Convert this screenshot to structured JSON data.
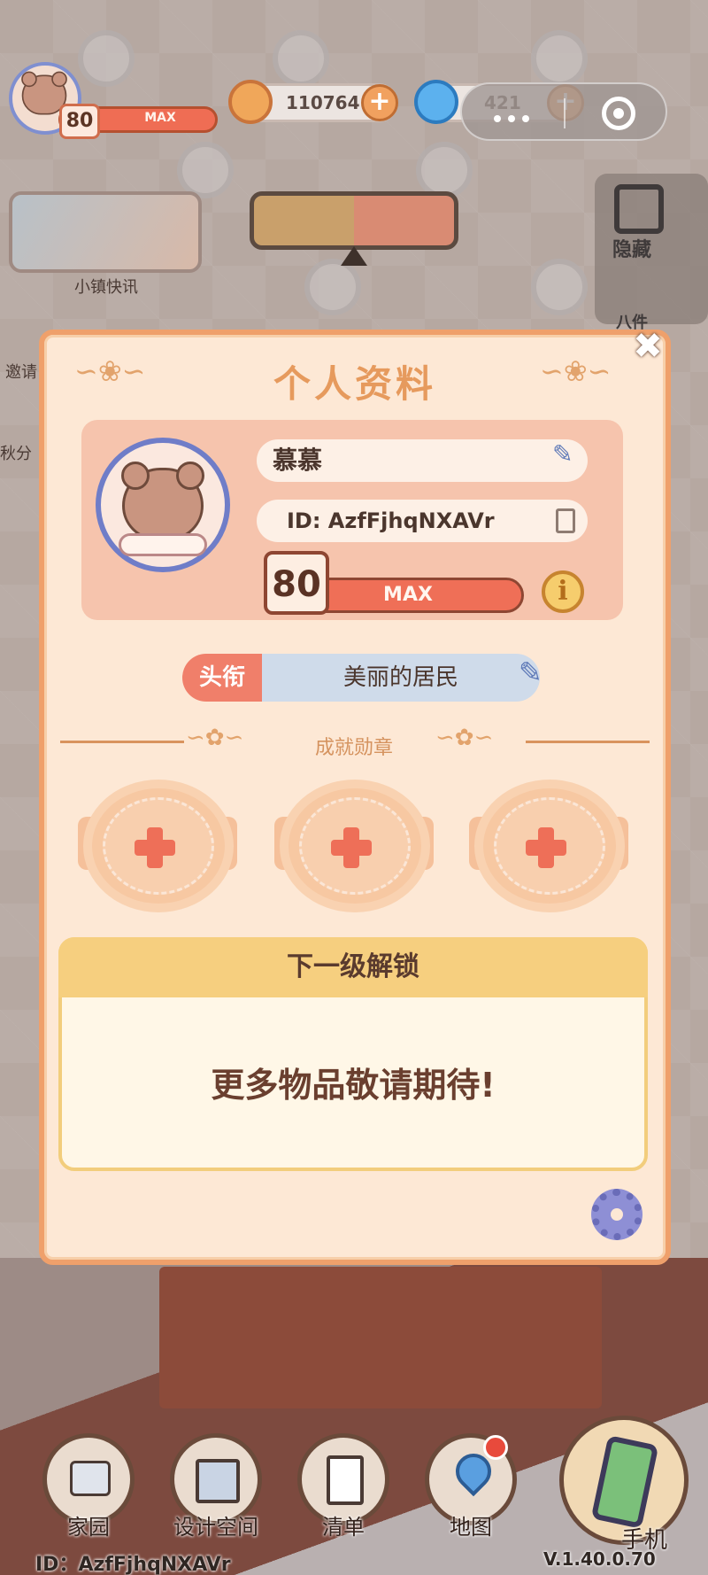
{
  "hud": {
    "level": "80",
    "level_max": "MAX",
    "coins": "110764",
    "gems": "421"
  },
  "sidebar_left": {
    "news_label": "小镇快讯",
    "invite_label": "邀请",
    "autumn_label": "秋分"
  },
  "sidebar_right": {
    "hide_label": "隐藏",
    "partial_label": "八件"
  },
  "modal": {
    "title": "个人资料",
    "nickname": "慕慕",
    "id_text": "ID: AzfFjhqNXAVr",
    "level": "80",
    "level_max": "MAX",
    "title_tag": "头衔",
    "title_value": "美丽的居民",
    "achievements_label": "成就勋章",
    "unlock_header": "下一级解锁",
    "unlock_message": "更多物品敬请期待!"
  },
  "bottom_nav": {
    "items": [
      {
        "label": "家园"
      },
      {
        "label": "设计空间"
      },
      {
        "label": "清单"
      },
      {
        "label": "地图"
      },
      {
        "label": "手机"
      }
    ],
    "player_id": "ID：AzfFjhqNXAVr",
    "version": "V.1.40.0.70"
  },
  "colors": {
    "modal_bg": "#fde8d5",
    "accent_orange": "#efa06b",
    "title_tag_bg": "#f07f6a",
    "title_value_bg": "#cfdbea"
  }
}
